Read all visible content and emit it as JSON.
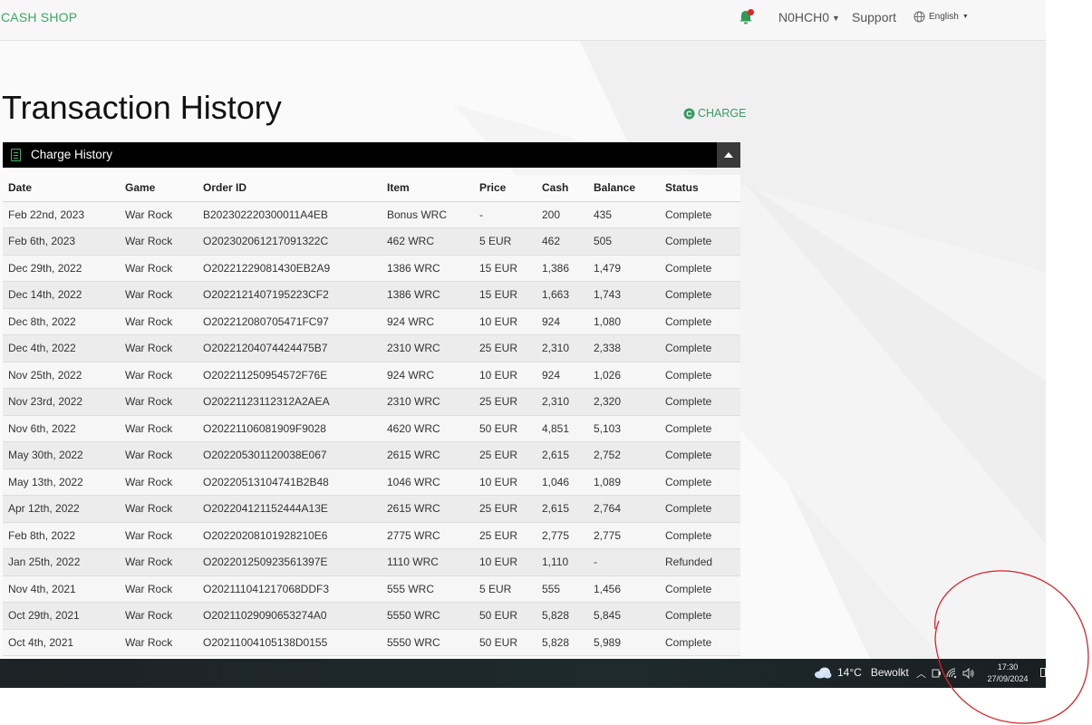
{
  "navbar": {
    "brand": "CASH SHOP",
    "user": "N0HCH0",
    "support": "Support",
    "language": "English"
  },
  "page": {
    "title": "Transaction History",
    "charge_label": "CHARGE"
  },
  "panel": {
    "title": "Charge History"
  },
  "table": {
    "columns": [
      "Date",
      "Game",
      "Order ID",
      "Item",
      "Price",
      "Cash",
      "Balance",
      "Status"
    ],
    "rows": [
      [
        "Feb 22nd, 2023",
        "War Rock",
        "B202302220300011A4EB",
        "Bonus WRC",
        "-",
        "200",
        "435",
        "Complete"
      ],
      [
        "Feb 6th, 2023",
        "War Rock",
        "O202302061217091322C",
        "462 WRC",
        "5 EUR",
        "462",
        "505",
        "Complete"
      ],
      [
        "Dec 29th, 2022",
        "War Rock",
        "O20221229081430EB2A9",
        "1386 WRC",
        "15 EUR",
        "1,386",
        "1,479",
        "Complete"
      ],
      [
        "Dec 14th, 2022",
        "War Rock",
        "O2022121407195223CF2",
        "1386 WRC",
        "15 EUR",
        "1,663",
        "1,743",
        "Complete"
      ],
      [
        "Dec 8th, 2022",
        "War Rock",
        "O202212080705471FC97",
        "924 WRC",
        "10 EUR",
        "924",
        "1,080",
        "Complete"
      ],
      [
        "Dec 4th, 2022",
        "War Rock",
        "O20221204074424475B7",
        "2310 WRC",
        "25 EUR",
        "2,310",
        "2,338",
        "Complete"
      ],
      [
        "Nov 25th, 2022",
        "War Rock",
        "O202211250954572F76E",
        "924 WRC",
        "10 EUR",
        "924",
        "1,026",
        "Complete"
      ],
      [
        "Nov 23rd, 2022",
        "War Rock",
        "O20221123112312A2AEA",
        "2310 WRC",
        "25 EUR",
        "2,310",
        "2,320",
        "Complete"
      ],
      [
        "Nov 6th, 2022",
        "War Rock",
        "O20221106081909F9028",
        "4620 WRC",
        "50 EUR",
        "4,851",
        "5,103",
        "Complete"
      ],
      [
        "May 30th, 2022",
        "War Rock",
        "O202205301120038E067",
        "2615 WRC",
        "25 EUR",
        "2,615",
        "2,752",
        "Complete"
      ],
      [
        "May 13th, 2022",
        "War Rock",
        "O20220513104741B2B48",
        "1046 WRC",
        "10 EUR",
        "1,046",
        "1,089",
        "Complete"
      ],
      [
        "Apr 12th, 2022",
        "War Rock",
        "O202204121152444A13E",
        "2615 WRC",
        "25 EUR",
        "2,615",
        "2,764",
        "Complete"
      ],
      [
        "Feb 8th, 2022",
        "War Rock",
        "O20220208101928210E6",
        "2775 WRC",
        "25 EUR",
        "2,775",
        "2,775",
        "Complete"
      ],
      [
        "Jan 25th, 2022",
        "War Rock",
        "O202201250923561397E",
        "1110 WRC",
        "10 EUR",
        "1,110",
        "-",
        "Refunded"
      ],
      [
        "Nov 4th, 2021",
        "War Rock",
        "O202111041217068DDF3",
        "555 WRC",
        "5 EUR",
        "555",
        "1,456",
        "Complete"
      ],
      [
        "Oct 29th, 2021",
        "War Rock",
        "O20211029090653274A0",
        "5550 WRC",
        "50 EUR",
        "5,828",
        "5,845",
        "Complete"
      ],
      [
        "Oct 4th, 2021",
        "War Rock",
        "O20211004105138D0155",
        "5550 WRC",
        "50 EUR",
        "5,828",
        "5,989",
        "Complete"
      ]
    ]
  },
  "taskbar": {
    "temperature": "14°C",
    "weather": "Bewolkt",
    "time": "17:30",
    "date": "27/09/2024"
  },
  "colors": {
    "brand_green": "#3aa865",
    "notification_dot": "#e02424",
    "annotation_red": "#d9232a",
    "panel_header": "#000000"
  },
  "icons": [
    "bell-icon",
    "globe-icon",
    "charge-icon",
    "document-icon",
    "collapse-icon",
    "cloud-icon",
    "chevron-up-icon",
    "network-icon",
    "volume-icon"
  ]
}
